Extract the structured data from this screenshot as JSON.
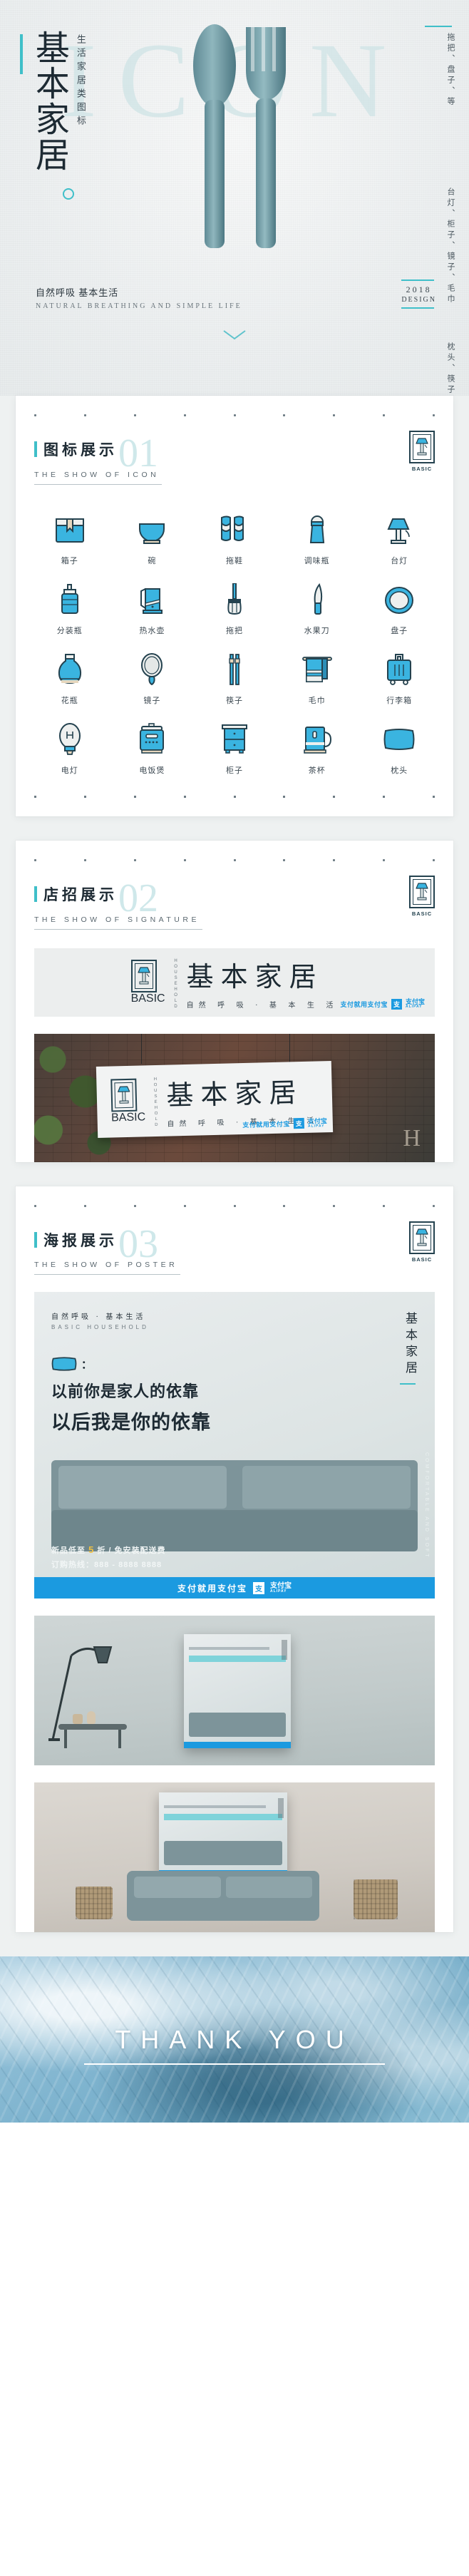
{
  "hero": {
    "title_cn": "基本家居",
    "title_sub": "生活家居类图标",
    "ghost": "ICON",
    "keywords_col1": "枕头、筷子、花瓶、拖鞋",
    "keywords_col2": "台灯、柜子、镜子、毛巾",
    "keywords_col3": "拖把、盘子、等",
    "slogan_cn": "自然呼吸 基本生活",
    "slogan_en": "NATURAL BREATHING AND SIMPLE LIFE",
    "year": "2018",
    "design": "DESIGN",
    "chevron_icon": "chevron-down-icon"
  },
  "logo": {
    "mark_icon": "lamp-icon",
    "basic": "BASIC",
    "household_vertical": "HOUSEHOLD"
  },
  "sections": [
    {
      "num": "01",
      "cn": "图标展示",
      "en": "THE SHOW OF ICON"
    },
    {
      "num": "02",
      "cn": "店招展示",
      "en": "THE SHOW OF SIGNATURE"
    },
    {
      "num": "03",
      "cn": "海报展示",
      "en": "THE SHOW OF POSTER"
    }
  ],
  "icons": [
    {
      "label": "箱子",
      "icon": "box-icon"
    },
    {
      "label": "碗",
      "icon": "bowl-icon"
    },
    {
      "label": "拖鞋",
      "icon": "slippers-icon"
    },
    {
      "label": "调味瓶",
      "icon": "spice-bottle-icon"
    },
    {
      "label": "台灯",
      "icon": "desk-lamp-icon"
    },
    {
      "label": "分装瓶",
      "icon": "dispenser-bottle-icon"
    },
    {
      "label": "热水壶",
      "icon": "kettle-icon"
    },
    {
      "label": "拖把",
      "icon": "mop-icon"
    },
    {
      "label": "水果刀",
      "icon": "fruit-knife-icon"
    },
    {
      "label": "盘子",
      "icon": "plate-icon"
    },
    {
      "label": "花瓶",
      "icon": "vase-icon"
    },
    {
      "label": "镜子",
      "icon": "hand-mirror-icon"
    },
    {
      "label": "筷子",
      "icon": "chopsticks-icon"
    },
    {
      "label": "毛巾",
      "icon": "towel-icon"
    },
    {
      "label": "行李箱",
      "icon": "suitcase-icon"
    },
    {
      "label": "电灯",
      "icon": "light-bulb-icon"
    },
    {
      "label": "电饭煲",
      "icon": "rice-cooker-icon"
    },
    {
      "label": "柜子",
      "icon": "cabinet-icon"
    },
    {
      "label": "茶杯",
      "icon": "tea-cup-icon"
    },
    {
      "label": "枕头",
      "icon": "pillow-icon"
    }
  ],
  "signature": {
    "brand_cn": "基本家居",
    "slogan": "自然 呼 吸 · 基 本 生 活",
    "vertical_en": "HOUSEHOLD",
    "basic": "BASIC"
  },
  "alipay": {
    "text": "支付就用支付宝",
    "mark": "支",
    "name": "支付宝",
    "sub": "ALIPAY"
  },
  "poster": {
    "kicker_cn": "自然呼吸 · 基本生活",
    "kicker_en": "BASIC HOUSEHOLD",
    "brand_vertical": "基本家居",
    "badge_icon": "pillow-icon",
    "colon": "：",
    "headline1": "以前你是家人的依靠",
    "headline2": "以后我是你的依靠",
    "side_en": "COMFORTABLE AND SOFT",
    "promo_prefix": "新品低至 ",
    "promo_num": "5",
    "promo_suffix": " 折  /  免安装配送费",
    "hotline": "订购热线：888 - 8888 8888",
    "cta_text": "支付就用支付宝"
  },
  "footer": {
    "thanks": "THANK YOU"
  },
  "colors": {
    "accent": "#3fbfc9",
    "icon_blue": "#3ab4e0",
    "ink": "#1d2a33",
    "alipay_blue": "#1b9ae0",
    "ghost": "#cfe8ea"
  }
}
